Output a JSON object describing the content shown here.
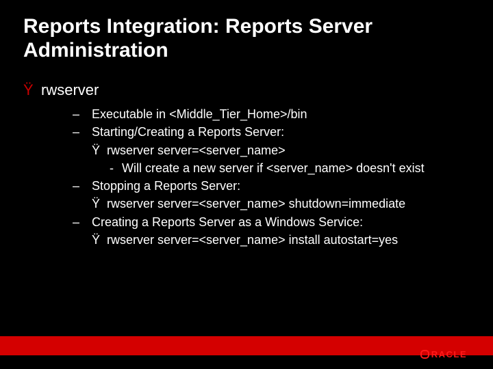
{
  "title": "Reports Integration: Reports Server Administration",
  "heading": "rwserver",
  "items": [
    {
      "text": "Executable in <Middle_Tier_Home>/bin"
    },
    {
      "text": "Starting/Creating a Reports Server:",
      "cmd": "rwserver server=<server_name>",
      "note": "Will create a new server if <server_name> doesn't exist"
    },
    {
      "text": "Stopping a Reports Server:",
      "cmd": "rwserver server=<server_name> shutdown=immediate"
    },
    {
      "text": "Creating a Reports Server as a Windows Service:",
      "cmd": "rwserver server=<server_name> install autostart=yes"
    }
  ],
  "logo": "RACLE"
}
